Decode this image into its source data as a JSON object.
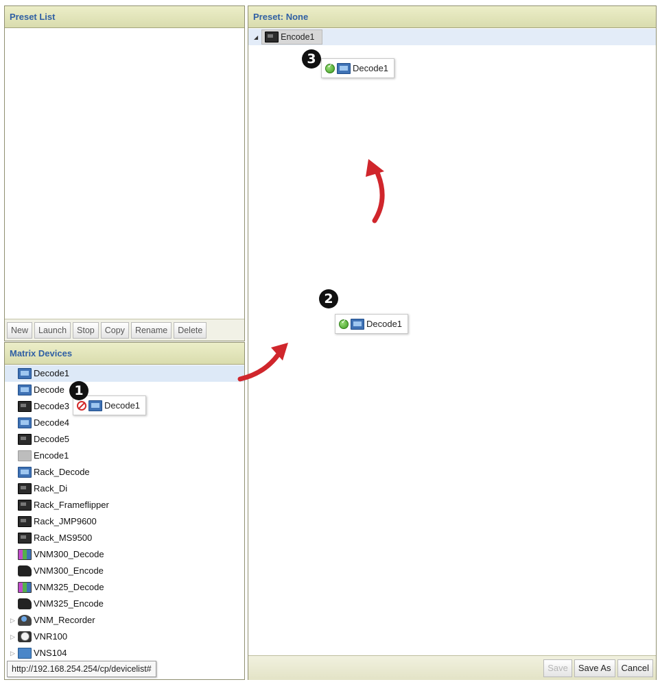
{
  "preset_list": {
    "title": "Preset List",
    "buttons": [
      "New",
      "Launch",
      "Stop",
      "Copy",
      "Rename",
      "Delete"
    ]
  },
  "matrix_devices": {
    "title": "Matrix Devices",
    "items": [
      {
        "label": "Decode1",
        "icon": "dvi-decoder-icon",
        "selected": true
      },
      {
        "label": "Decode",
        "icon": "dvi-decoder-icon"
      },
      {
        "label": "Decode3",
        "icon": "dvi-device-icon"
      },
      {
        "label": "Decode4",
        "icon": "dvi-decoder-icon"
      },
      {
        "label": "Decode5",
        "icon": "dvi-device-icon"
      },
      {
        "label": "Encode1",
        "icon": "dvi-encoder-disabled-icon"
      },
      {
        "label": "Rack_Decode",
        "icon": "dvi-decoder-icon"
      },
      {
        "label": "Rack_Di",
        "icon": "dvi-device-icon"
      },
      {
        "label": "Rack_Frameflipper",
        "icon": "dvi-device-icon"
      },
      {
        "label": "Rack_JMP9600",
        "icon": "dvi-device-icon"
      },
      {
        "label": "Rack_MS9500",
        "icon": "dvi-device-icon"
      },
      {
        "label": "VNM300_Decode",
        "icon": "sdi-decoder-icon"
      },
      {
        "label": "VNM300_Encode",
        "icon": "sdi-camera-icon"
      },
      {
        "label": "VNM325_Decode",
        "icon": "sdi-decoder-icon"
      },
      {
        "label": "VNM325_Encode",
        "icon": "sdi-camera-icon"
      },
      {
        "label": "VNM_Recorder",
        "icon": "recorder-icon",
        "expandable": true
      },
      {
        "label": "VNR100",
        "icon": "vnr-icon",
        "expandable": true
      },
      {
        "label": "VNS104",
        "icon": "vns-icon",
        "expandable": true
      }
    ],
    "status_url": "http://192.168.254.254/cp/devicelist#"
  },
  "preset_panel": {
    "title": "Preset: None",
    "encoder_node": "Encode1",
    "drag_item_label": "Decode1",
    "step_numbers": [
      "1",
      "2",
      "3"
    ],
    "footer_buttons": [
      {
        "label": "Save",
        "disabled": true
      },
      {
        "label": "Save As",
        "disabled": false
      },
      {
        "label": "Cancel",
        "disabled": false
      }
    ]
  },
  "colors": {
    "header_text": "#2f5fa3",
    "header_bg": "#d9dcae",
    "selected_row": "#dde9f7",
    "arrow": "#d0262c"
  }
}
